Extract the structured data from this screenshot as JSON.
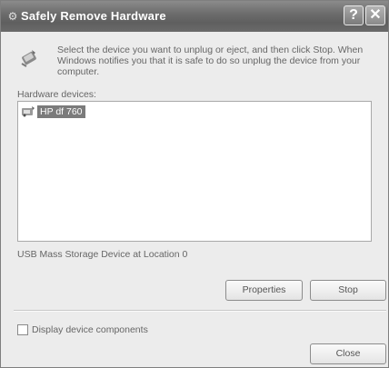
{
  "window": {
    "title": "Safely Remove Hardware",
    "help_symbol": "?",
    "close_symbol": "✕"
  },
  "instructions": "Select the device you want to unplug or eject, and then click Stop. When Windows notifies you that it is safe to do so unplug the device from your computer.",
  "hardware_label": "Hardware devices:",
  "devices": [
    {
      "label": "HP df 760",
      "icon": "usb-device-icon",
      "selected": true
    }
  ],
  "status_text": "USB Mass Storage Device at Location 0",
  "buttons": {
    "properties": "Properties",
    "stop": "Stop",
    "close": "Close"
  },
  "checkbox": {
    "label": "Display device components",
    "checked": false
  }
}
